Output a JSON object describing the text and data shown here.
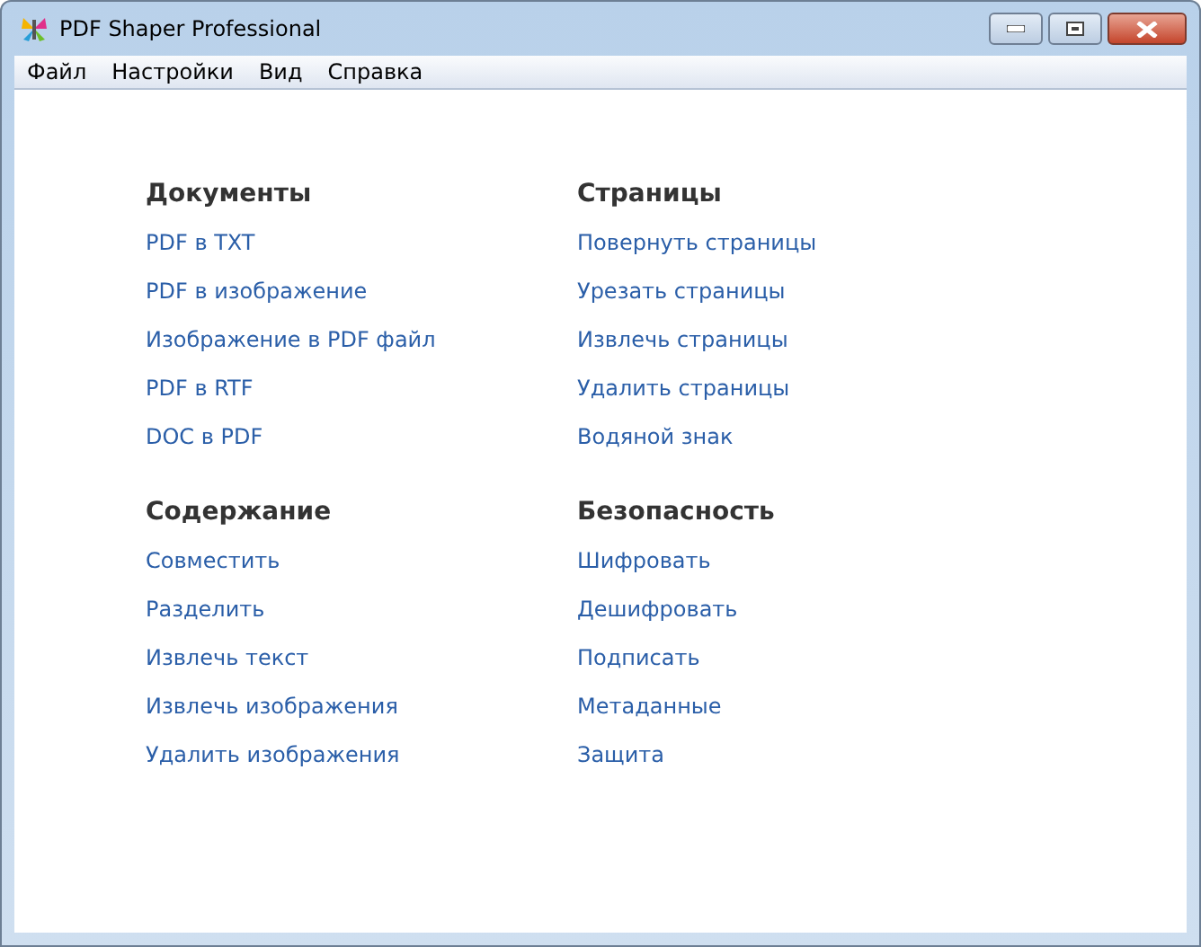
{
  "window": {
    "title": "PDF Shaper Professional"
  },
  "menu": [
    "Файл",
    "Настройки",
    "Вид",
    "Справка"
  ],
  "columns": [
    {
      "sections": [
        {
          "title": "Документы",
          "links": [
            "PDF в TXT",
            "PDF в изображение",
            "Изображение в PDF файл",
            "PDF в RTF",
            "DOC в PDF"
          ]
        },
        {
          "title": "Содержание",
          "links": [
            "Совместить",
            "Разделить",
            "Извлечь текст",
            "Извлечь изображения",
            "Удалить изображения"
          ]
        }
      ]
    },
    {
      "sections": [
        {
          "title": "Страницы",
          "links": [
            "Повернуть страницы",
            "Урезать страницы",
            "Извлечь страницы",
            "Удалить страницы",
            "Водяной знак"
          ]
        },
        {
          "title": "Безопасность",
          "links": [
            "Шифровать",
            "Дешифровать",
            "Подписать",
            "Метаданные",
            "Защита"
          ]
        }
      ]
    }
  ]
}
